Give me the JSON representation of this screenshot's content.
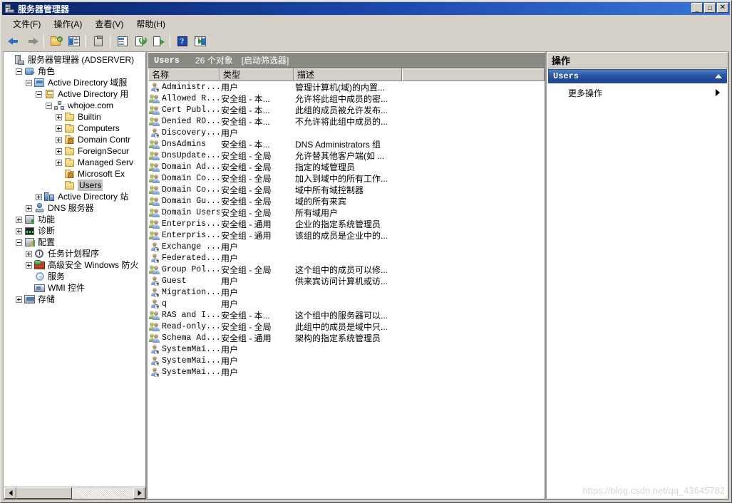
{
  "window": {
    "title": "服务器管理器",
    "icon": "server-icon",
    "buttons": {
      "minimize": "_",
      "maximize": "□",
      "close": "✕"
    }
  },
  "menubar": [
    {
      "label": "文件(F)",
      "name": "menu-file"
    },
    {
      "label": "操作(A)",
      "name": "menu-action"
    },
    {
      "label": "查看(V)",
      "name": "menu-view"
    },
    {
      "label": "帮助(H)",
      "name": "menu-help"
    }
  ],
  "toolbar": [
    {
      "name": "back-button",
      "icon": "back-arrow-icon"
    },
    {
      "name": "forward-button",
      "icon": "forward-arrow-icon"
    },
    {
      "name": "up-folder-button",
      "icon": "folder-key-icon"
    },
    {
      "name": "show-hide-tree-button",
      "icon": "tree-pane-icon"
    },
    {
      "name": "properties-button",
      "icon": "clipboard-icon"
    },
    {
      "name": "view-button",
      "icon": "document-icon"
    },
    {
      "name": "refresh-button",
      "icon": "refresh-icon"
    },
    {
      "name": "export-list-button",
      "icon": "export-icon"
    },
    {
      "name": "help-button",
      "icon": "help-icon"
    },
    {
      "name": "show-action-pane-button",
      "icon": "action-pane-icon"
    }
  ],
  "tree": {
    "nodes": [
      {
        "label": "服务器管理器 (ADSERVER)",
        "indent": 0,
        "expander": "none",
        "icon": "server-icon",
        "selected": false
      },
      {
        "label": "角色",
        "indent": 1,
        "expander": "minus",
        "icon": "roles-icon",
        "selected": false
      },
      {
        "label": "Active Directory 域服",
        "indent": 2,
        "expander": "minus",
        "icon": "ad-ds-icon",
        "selected": false
      },
      {
        "label": "Active Directory 用",
        "indent": 3,
        "expander": "minus",
        "icon": "ad-users-icon",
        "selected": false
      },
      {
        "label": "whojoe.com",
        "indent": 4,
        "expander": "minus",
        "icon": "domain-icon",
        "selected": false
      },
      {
        "label": "Builtin",
        "indent": 5,
        "expander": "plus",
        "icon": "folder-icon",
        "selected": false
      },
      {
        "label": "Computers",
        "indent": 5,
        "expander": "plus",
        "icon": "folder-icon",
        "selected": false
      },
      {
        "label": "Domain Contr",
        "indent": 5,
        "expander": "plus",
        "icon": "folder-special-icon",
        "selected": false
      },
      {
        "label": "ForeignSecur",
        "indent": 5,
        "expander": "plus",
        "icon": "folder-icon",
        "selected": false
      },
      {
        "label": "Managed Serv",
        "indent": 5,
        "expander": "plus",
        "icon": "folder-icon",
        "selected": false
      },
      {
        "label": "Microsoft Ex",
        "indent": 5,
        "expander": "none",
        "icon": "folder-special-icon",
        "selected": false
      },
      {
        "label": "Users",
        "indent": 5,
        "expander": "none",
        "icon": "folder-icon",
        "selected": true
      },
      {
        "label": "Active Directory 站",
        "indent": 3,
        "expander": "plus",
        "icon": "ad-sites-icon",
        "selected": false
      },
      {
        "label": "DNS 服务器",
        "indent": 2,
        "expander": "plus",
        "icon": "dns-icon",
        "selected": false
      },
      {
        "label": "功能",
        "indent": 1,
        "expander": "plus",
        "icon": "features-icon",
        "selected": false
      },
      {
        "label": "诊断",
        "indent": 1,
        "expander": "plus",
        "icon": "diagnostics-icon",
        "selected": false
      },
      {
        "label": "配置",
        "indent": 1,
        "expander": "minus",
        "icon": "configuration-icon",
        "selected": false
      },
      {
        "label": "任务计划程序",
        "indent": 2,
        "expander": "plus",
        "icon": "clock-icon",
        "selected": false
      },
      {
        "label": "高级安全 Windows 防火",
        "indent": 2,
        "expander": "plus",
        "icon": "firewall-icon",
        "selected": false
      },
      {
        "label": "服务",
        "indent": 2,
        "expander": "none",
        "icon": "gear-icon",
        "selected": false
      },
      {
        "label": "WMI 控件",
        "indent": 2,
        "expander": "none",
        "icon": "wmi-icon",
        "selected": false
      },
      {
        "label": "存储",
        "indent": 1,
        "expander": "plus",
        "icon": "storage-icon",
        "selected": false
      }
    ],
    "hscroll": {
      "left_arrow": "◄",
      "right_arrow": "►"
    }
  },
  "list": {
    "header": {
      "title": "Users",
      "count": "26 个对象",
      "filter": "[启动筛选器]"
    },
    "columns": [
      {
        "label": "名称",
        "name": "column-header-name"
      },
      {
        "label": "类型",
        "name": "column-header-type"
      },
      {
        "label": "描述",
        "name": "column-header-description"
      },
      {
        "label": "",
        "name": "column-header-blank"
      }
    ],
    "rows": [
      {
        "icon": "user-icon",
        "name": "Administr...",
        "type": "用户",
        "description": "管理计算机(域)的内置..."
      },
      {
        "icon": "group-icon",
        "name": "Allowed R...",
        "type": "安全组 - 本...",
        "description": "允许将此组中成员的密..."
      },
      {
        "icon": "group-icon",
        "name": "Cert Publ...",
        "type": "安全组 - 本...",
        "description": "此组的成员被允许发布..."
      },
      {
        "icon": "group-icon",
        "name": "Denied RO...",
        "type": "安全组 - 本...",
        "description": "不允许将此组中成员的..."
      },
      {
        "icon": "user-icon",
        "name": "Discovery...",
        "type": "用户",
        "description": ""
      },
      {
        "icon": "group-icon",
        "name": "DnsAdmins",
        "type": "安全组 - 本...",
        "description": "DNS Administrators 组"
      },
      {
        "icon": "group-icon",
        "name": "DnsUpdate...",
        "type": "安全组 - 全局",
        "description": "允许替其他客户端(如 ..."
      },
      {
        "icon": "group-icon",
        "name": "Domain Ad...",
        "type": "安全组 - 全局",
        "description": "指定的域管理员"
      },
      {
        "icon": "group-icon",
        "name": "Domain Co...",
        "type": "安全组 - 全局",
        "description": "加入到域中的所有工作..."
      },
      {
        "icon": "group-icon",
        "name": "Domain Co...",
        "type": "安全组 - 全局",
        "description": "域中所有域控制器"
      },
      {
        "icon": "group-icon",
        "name": "Domain Gu...",
        "type": "安全组 - 全局",
        "description": "域的所有来宾"
      },
      {
        "icon": "group-icon",
        "name": "Domain Users",
        "type": "安全组 - 全局",
        "description": "所有域用户"
      },
      {
        "icon": "group-icon",
        "name": "Enterpris...",
        "type": "安全组 - 通用",
        "description": "企业的指定系统管理员"
      },
      {
        "icon": "group-icon",
        "name": "Enterpris...",
        "type": "安全组 - 通用",
        "description": "该组的成员是企业中的..."
      },
      {
        "icon": "user-icon",
        "name": "Exchange ...",
        "type": "用户",
        "description": ""
      },
      {
        "icon": "user-icon",
        "name": "Federated...",
        "type": "用户",
        "description": ""
      },
      {
        "icon": "group-icon",
        "name": "Group Pol...",
        "type": "安全组 - 全局",
        "description": "这个组中的成员可以修..."
      },
      {
        "icon": "user-icon",
        "name": "Guest",
        "type": "用户",
        "description": "供来宾访问计算机或访..."
      },
      {
        "icon": "user-icon",
        "name": "Migration...",
        "type": "用户",
        "description": ""
      },
      {
        "icon": "user-icon",
        "name": "q",
        "type": "用户",
        "description": ""
      },
      {
        "icon": "group-icon",
        "name": "RAS and I...",
        "type": "安全组 - 本...",
        "description": "这个组中的服务器可以..."
      },
      {
        "icon": "group-icon",
        "name": "Read-only...",
        "type": "安全组 - 全局",
        "description": "此组中的成员是域中只..."
      },
      {
        "icon": "group-icon",
        "name": "Schema Ad...",
        "type": "安全组 - 通用",
        "description": "架构的指定系统管理员"
      },
      {
        "icon": "user-icon",
        "name": "SystemMai...",
        "type": "用户",
        "description": ""
      },
      {
        "icon": "user-icon",
        "name": "SystemMai...",
        "type": "用户",
        "description": ""
      },
      {
        "icon": "user-icon",
        "name": "SystemMai...",
        "type": "用户",
        "description": ""
      }
    ]
  },
  "actions": {
    "title": "操作",
    "group_title": "Users",
    "collapse_icon": "chevron-up-icon",
    "items": [
      {
        "label": "更多操作",
        "submenu_icon": "chevron-right-icon",
        "name": "action-more-actions"
      }
    ]
  },
  "watermark": "https://blog.csdn.net/qq_43645782",
  "colors": {
    "titlebar_start": "#0a246a",
    "titlebar_end": "#3b74d6",
    "window_face": "#d4d0c8",
    "list_header_bg": "#8a8a82",
    "action_group_bg": "#2a55a0",
    "selection_inactive": "#c0c0c0"
  }
}
